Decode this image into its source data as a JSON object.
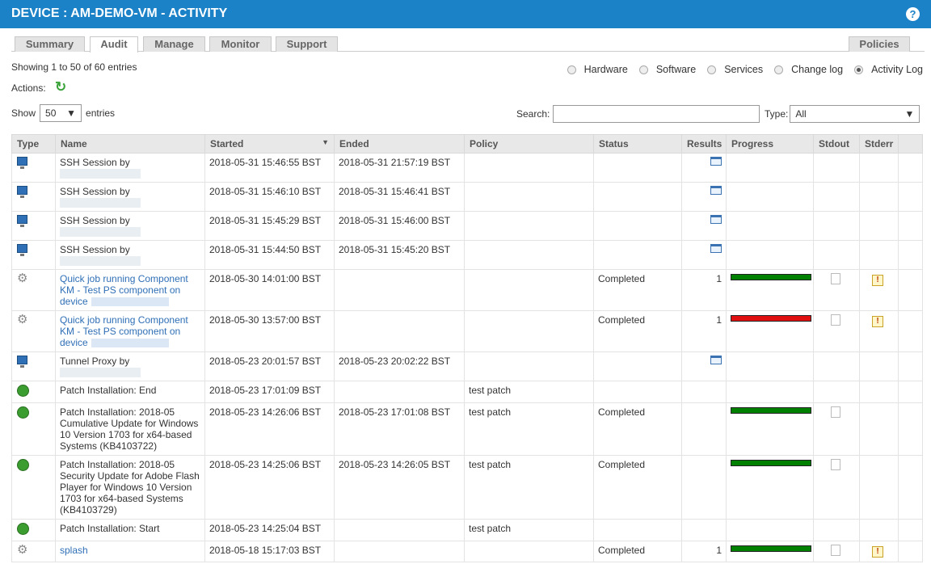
{
  "header": {
    "title": "DEVICE : AM-DEMO-VM - ACTIVITY",
    "help": "?"
  },
  "tabs": [
    {
      "label": "Summary",
      "active": false
    },
    {
      "label": "Audit",
      "active": true
    },
    {
      "label": "Manage",
      "active": false
    },
    {
      "label": "Monitor",
      "active": false
    },
    {
      "label": "Support",
      "active": false
    }
  ],
  "policies_tab": "Policies",
  "showing": "Showing 1 to 50 of 60 entries",
  "views": [
    {
      "label": "Hardware",
      "selected": false
    },
    {
      "label": "Software",
      "selected": false
    },
    {
      "label": "Services",
      "selected": false
    },
    {
      "label": "Change log",
      "selected": false
    },
    {
      "label": "Activity Log",
      "selected": true
    }
  ],
  "actions_label": "Actions:",
  "show_label": "Show",
  "show_value": "50",
  "entries_label": "entries",
  "search_label": "Search:",
  "search_value": "",
  "type_label": "Type:",
  "type_value": "All",
  "columns": [
    "Type",
    "Name",
    "Started",
    "Ended",
    "Policy",
    "Status",
    "Results",
    "Progress",
    "Stdout",
    "Stderr"
  ],
  "colors": {
    "header_bg": "#1b82c8",
    "progress_ok": "#008000",
    "progress_fail": "#e01010",
    "link": "#2f6fb6"
  },
  "rows": [
    {
      "icon": "computer-icon",
      "name": "SSH Session by",
      "blur": true,
      "link": false,
      "started": "2018-05-31 15:46:55 BST",
      "ended": "2018-05-31 21:57:19 BST",
      "policy": "",
      "status": "",
      "results": "",
      "has_results_icon": true,
      "progress": null,
      "stdout": false,
      "stderr": false
    },
    {
      "icon": "computer-icon",
      "name": "SSH Session by",
      "blur": true,
      "link": false,
      "started": "2018-05-31 15:46:10 BST",
      "ended": "2018-05-31 15:46:41 BST",
      "policy": "",
      "status": "",
      "results": "",
      "has_results_icon": true,
      "progress": null,
      "stdout": false,
      "stderr": false
    },
    {
      "icon": "computer-icon",
      "name": "SSH Session by",
      "blur": true,
      "link": false,
      "started": "2018-05-31 15:45:29 BST",
      "ended": "2018-05-31 15:46:00 BST",
      "policy": "",
      "status": "",
      "results": "",
      "has_results_icon": true,
      "progress": null,
      "stdout": false,
      "stderr": false
    },
    {
      "icon": "computer-icon",
      "name": "SSH Session by",
      "blur": true,
      "link": false,
      "started": "2018-05-31 15:44:50 BST",
      "ended": "2018-05-31 15:45:20 BST",
      "policy": "",
      "status": "",
      "results": "",
      "has_results_icon": true,
      "progress": null,
      "stdout": false,
      "stderr": false
    },
    {
      "icon": "gear-icon",
      "name": "Quick job running Component KM - Test PS component on device",
      "blur": false,
      "link": true,
      "started": "2018-05-30 14:01:00 BST",
      "ended": "",
      "policy": "",
      "status": "Completed",
      "results": "1",
      "has_results_icon": false,
      "progress": "ok",
      "stdout": true,
      "stderr": true
    },
    {
      "icon": "gear-icon",
      "name": "Quick job running Component KM - Test PS component on device",
      "blur": false,
      "link": true,
      "started": "2018-05-30 13:57:00 BST",
      "ended": "",
      "policy": "",
      "status": "Completed",
      "results": "1",
      "has_results_icon": false,
      "progress": "fail",
      "stdout": true,
      "stderr": true
    },
    {
      "icon": "computer-icon",
      "name": "Tunnel Proxy by",
      "blur": true,
      "link": false,
      "started": "2018-05-23 20:01:57 BST",
      "ended": "2018-05-23 20:02:22 BST",
      "policy": "",
      "status": "",
      "results": "",
      "has_results_icon": true,
      "progress": null,
      "stdout": false,
      "stderr": false
    },
    {
      "icon": "green-status-icon",
      "name": "Patch Installation: End",
      "blur": false,
      "link": false,
      "started": "2018-05-23 17:01:09 BST",
      "ended": "",
      "policy": "test patch",
      "status": "",
      "results": "",
      "has_results_icon": false,
      "progress": null,
      "stdout": false,
      "stderr": false
    },
    {
      "icon": "green-status-icon",
      "name": "Patch Installation: 2018-05 Cumulative Update for Windows 10 Version 1703 for x64-based Systems (KB4103722)",
      "blur": false,
      "link": false,
      "started": "2018-05-23 14:26:06 BST",
      "ended": "2018-05-23 17:01:08 BST",
      "policy": "test patch",
      "status": "Completed",
      "results": "",
      "has_results_icon": false,
      "progress": "ok",
      "stdout": true,
      "stderr": false
    },
    {
      "icon": "green-status-icon",
      "name": "Patch Installation: 2018-05 Security Update for Adobe Flash Player for Windows 10 Version 1703 for x64-based Systems (KB4103729)",
      "blur": false,
      "link": false,
      "started": "2018-05-23 14:25:06 BST",
      "ended": "2018-05-23 14:26:05 BST",
      "policy": "test patch",
      "status": "Completed",
      "results": "",
      "has_results_icon": false,
      "progress": "ok",
      "stdout": true,
      "stderr": false
    },
    {
      "icon": "green-status-icon",
      "name": "Patch Installation: Start",
      "blur": false,
      "link": false,
      "started": "2018-05-23 14:25:04 BST",
      "ended": "",
      "policy": "test patch",
      "status": "",
      "results": "",
      "has_results_icon": false,
      "progress": null,
      "stdout": false,
      "stderr": false
    },
    {
      "icon": "gear-icon",
      "name": "splash",
      "blur": false,
      "link": true,
      "started": "2018-05-18 15:17:03 BST",
      "ended": "",
      "policy": "",
      "status": "Completed",
      "results": "1",
      "has_results_icon": false,
      "progress": "ok",
      "stdout": true,
      "stderr": true
    }
  ]
}
